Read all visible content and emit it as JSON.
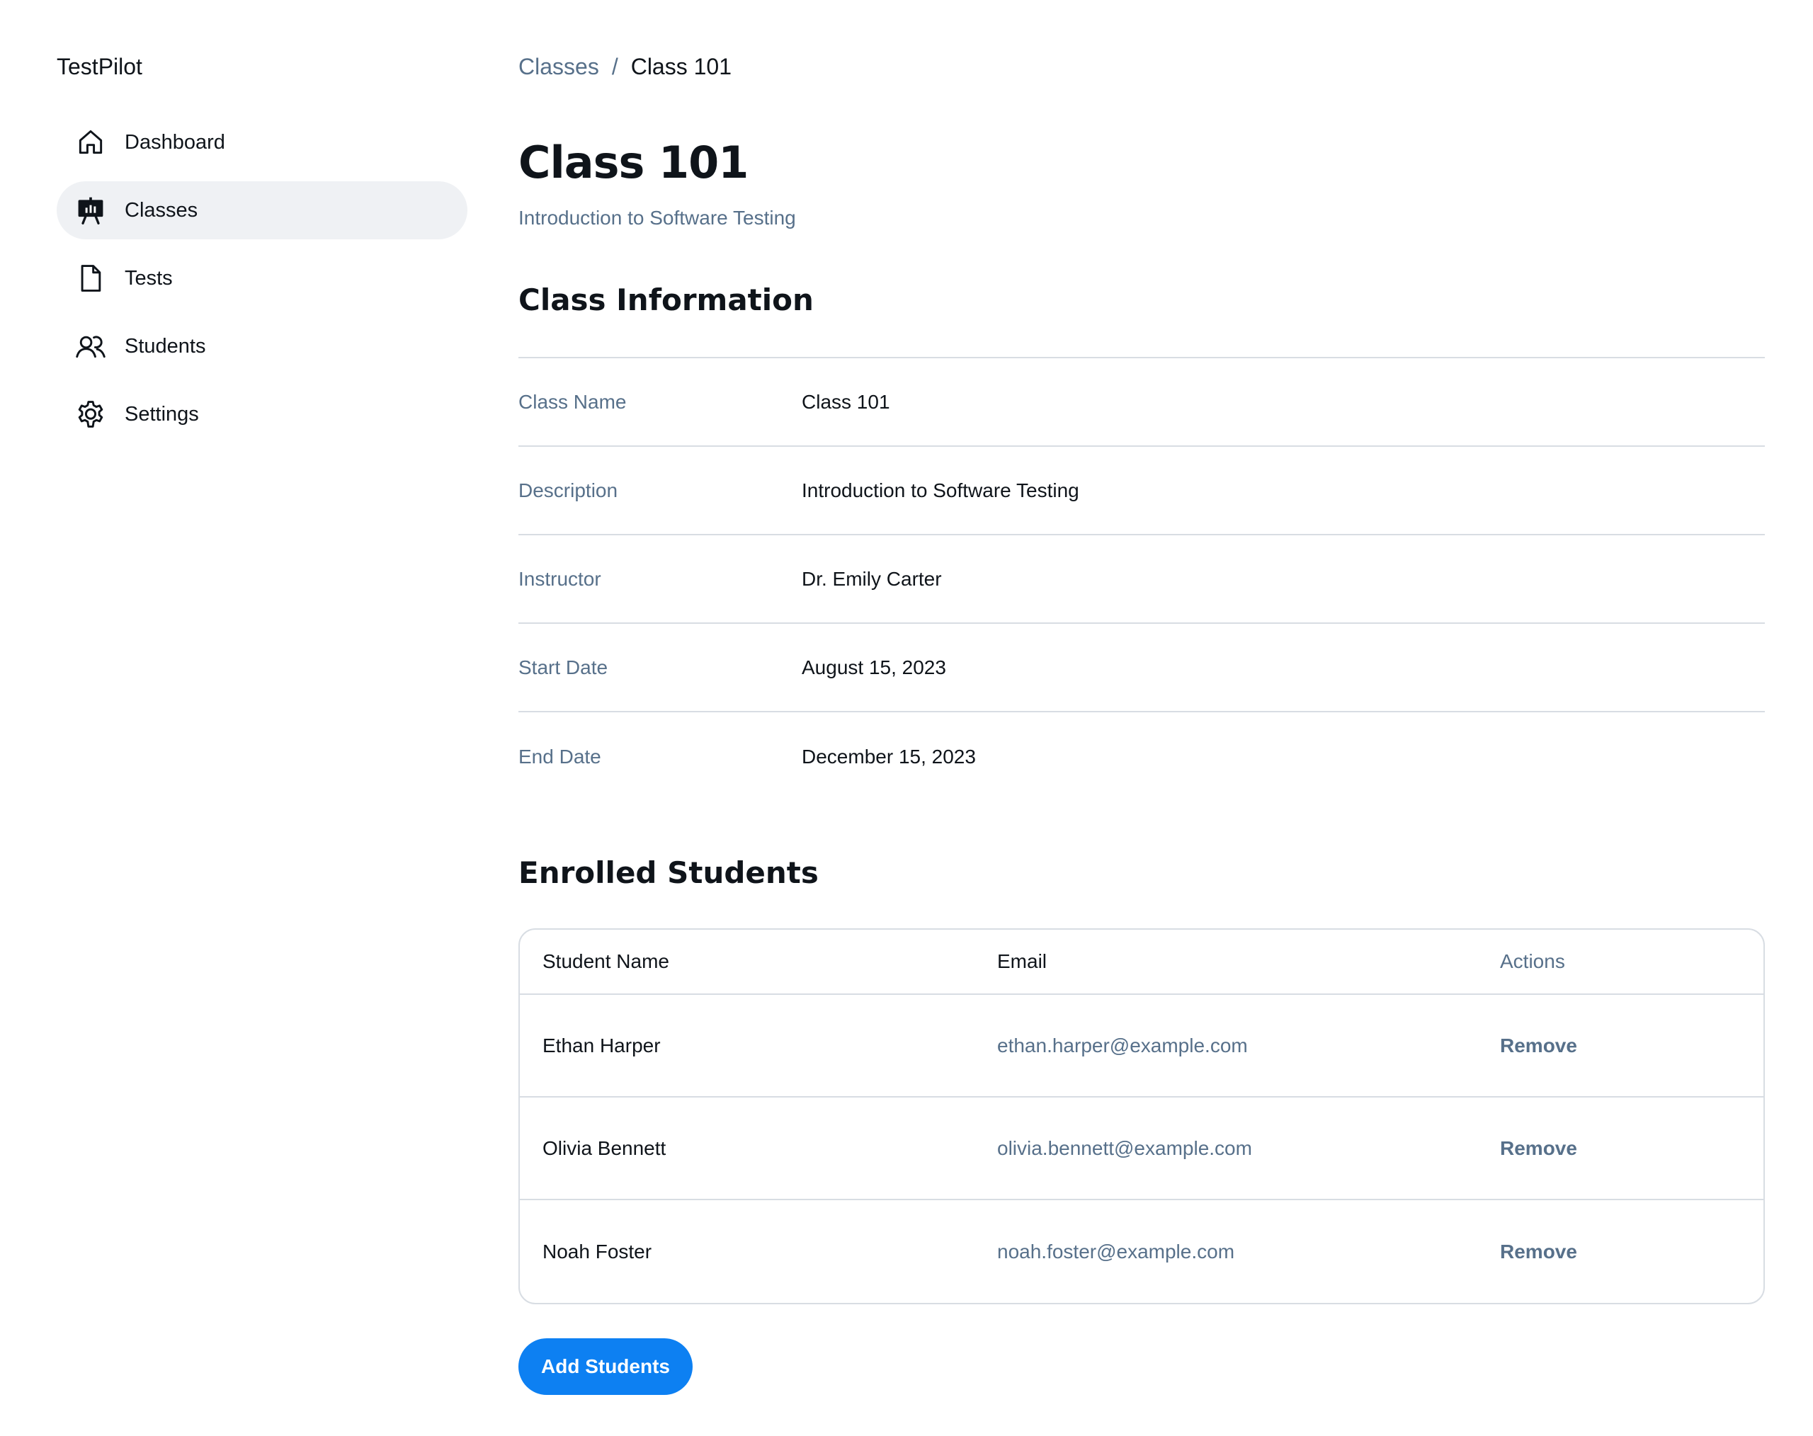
{
  "app": {
    "title": "TestPilot"
  },
  "sidebar": {
    "items": [
      {
        "label": "Dashboard",
        "icon": "house-icon",
        "active": false
      },
      {
        "label": "Classes",
        "icon": "presentation-chart-icon",
        "active": true
      },
      {
        "label": "Tests",
        "icon": "file-icon",
        "active": false
      },
      {
        "label": "Students",
        "icon": "users-icon",
        "active": false
      },
      {
        "label": "Settings",
        "icon": "gear-icon",
        "active": false
      }
    ]
  },
  "breadcrumb": {
    "parent": "Classes",
    "separator": "/",
    "current": "Class 101"
  },
  "page": {
    "title": "Class 101",
    "subtitle": "Introduction to Software Testing"
  },
  "class_info": {
    "title": "Class Information",
    "rows": [
      {
        "label": "Class Name",
        "value": "Class 101"
      },
      {
        "label": "Description",
        "value": "Introduction to Software Testing"
      },
      {
        "label": "Instructor",
        "value": "Dr. Emily Carter"
      },
      {
        "label": "Start Date",
        "value": "August 15, 2023"
      },
      {
        "label": "End Date",
        "value": "December 15, 2023"
      }
    ]
  },
  "students": {
    "title": "Enrolled Students",
    "columns": {
      "name": "Student Name",
      "email": "Email",
      "actions": "Actions"
    },
    "rows": [
      {
        "name": "Ethan Harper",
        "email": "ethan.harper@example.com",
        "action": "Remove"
      },
      {
        "name": "Olivia Bennett",
        "email": "olivia.bennett@example.com",
        "action": "Remove"
      },
      {
        "name": "Noah Foster",
        "email": "noah.foster@example.com",
        "action": "Remove"
      }
    ],
    "add_button": "Add Students"
  },
  "colors": {
    "accent": "#0d80f2",
    "muted_text": "#57708a",
    "text": "#0f141a",
    "active_nav_bg": "#eff1f4",
    "border": "#d8dde3"
  }
}
